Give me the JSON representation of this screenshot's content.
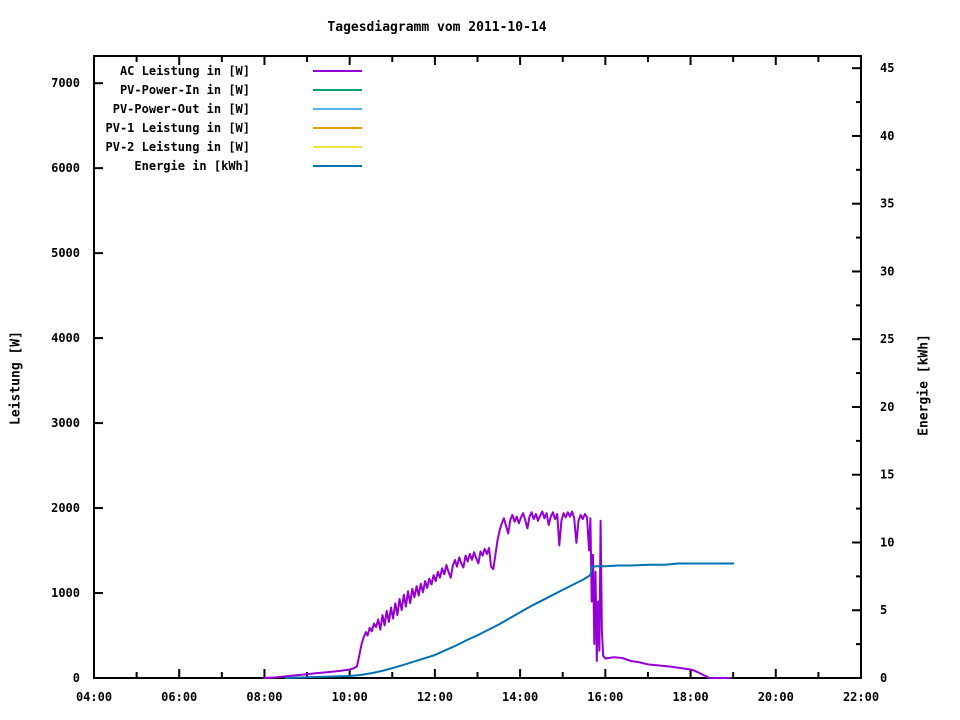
{
  "chart_data": {
    "type": "line",
    "title": "Tagesdiagramm vom 2011-10-14",
    "ylabel": "Leistung [W]",
    "y2label": "Energie [kWh]",
    "grid": false,
    "legend_position": "top-left-inside",
    "x_axis": {
      "min": 4,
      "max": 22,
      "major_ticks": [
        {
          "t": 4,
          "label": "04:00"
        },
        {
          "t": 6,
          "label": "06:00"
        },
        {
          "t": 8,
          "label": "08:00"
        },
        {
          "t": 10,
          "label": "10:00"
        },
        {
          "t": 12,
          "label": "12:00"
        },
        {
          "t": 14,
          "label": "14:00"
        },
        {
          "t": 16,
          "label": "16:00"
        },
        {
          "t": 18,
          "label": "18:00"
        },
        {
          "t": 20,
          "label": "20:00"
        },
        {
          "t": 22,
          "label": "22:00"
        }
      ],
      "minor_ticks": [
        5,
        7,
        9,
        11,
        13,
        15,
        17,
        19,
        21
      ]
    },
    "y_axis": {
      "min": 0,
      "max": 7320,
      "ticks": [
        0,
        1000,
        2000,
        3000,
        4000,
        5000,
        6000,
        7000
      ]
    },
    "y2_axis": {
      "min": 0,
      "max": 45.9,
      "ticks": [
        0,
        5,
        10,
        15,
        20,
        25,
        30,
        35,
        40,
        45
      ],
      "minor_ticks": [
        2.5,
        7.5,
        12.5,
        17.5,
        22.5,
        27.5,
        32.5,
        37.5,
        42.5
      ]
    },
    "series": [
      {
        "name": "AC Leistung in [W]",
        "color": "#9400d3",
        "axis": "y1",
        "points": [
          [
            8.0,
            0
          ],
          [
            8.3,
            10
          ],
          [
            8.6,
            25
          ],
          [
            8.9,
            40
          ],
          [
            9.2,
            55
          ],
          [
            9.5,
            70
          ],
          [
            9.8,
            85
          ],
          [
            10.0,
            100
          ],
          [
            10.1,
            115
          ],
          [
            10.17,
            135
          ],
          [
            10.22,
            250
          ],
          [
            10.28,
            400
          ],
          [
            10.33,
            480
          ],
          [
            10.38,
            540
          ],
          [
            10.42,
            500
          ],
          [
            10.47,
            590
          ],
          [
            10.52,
            550
          ],
          [
            10.57,
            640
          ],
          [
            10.62,
            600
          ],
          [
            10.67,
            690
          ],
          [
            10.72,
            570
          ],
          [
            10.77,
            740
          ],
          [
            10.82,
            620
          ],
          [
            10.87,
            790
          ],
          [
            10.92,
            660
          ],
          [
            10.97,
            830
          ],
          [
            11.02,
            700
          ],
          [
            11.07,
            880
          ],
          [
            11.12,
            740
          ],
          [
            11.17,
            930
          ],
          [
            11.22,
            800
          ],
          [
            11.27,
            980
          ],
          [
            11.32,
            840
          ],
          [
            11.37,
            1020
          ],
          [
            11.42,
            880
          ],
          [
            11.47,
            1050
          ],
          [
            11.52,
            950
          ],
          [
            11.57,
            1080
          ],
          [
            11.62,
            970
          ],
          [
            11.67,
            1110
          ],
          [
            11.72,
            1010
          ],
          [
            11.77,
            1140
          ],
          [
            11.82,
            1060
          ],
          [
            11.87,
            1170
          ],
          [
            11.92,
            1100
          ],
          [
            11.97,
            1210
          ],
          [
            12.02,
            1140
          ],
          [
            12.07,
            1250
          ],
          [
            12.12,
            1180
          ],
          [
            12.17,
            1290
          ],
          [
            12.22,
            1220
          ],
          [
            12.27,
            1330
          ],
          [
            12.32,
            1250
          ],
          [
            12.37,
            1180
          ],
          [
            12.42,
            1320
          ],
          [
            12.47,
            1390
          ],
          [
            12.52,
            1310
          ],
          [
            12.57,
            1420
          ],
          [
            12.62,
            1350
          ],
          [
            12.67,
            1300
          ],
          [
            12.72,
            1440
          ],
          [
            12.77,
            1370
          ],
          [
            12.82,
            1460
          ],
          [
            12.87,
            1390
          ],
          [
            12.92,
            1480
          ],
          [
            12.97,
            1410
          ],
          [
            13.02,
            1350
          ],
          [
            13.07,
            1490
          ],
          [
            13.12,
            1440
          ],
          [
            13.17,
            1520
          ],
          [
            13.22,
            1460
          ],
          [
            13.27,
            1530
          ],
          [
            13.32,
            1310
          ],
          [
            13.37,
            1280
          ],
          [
            13.42,
            1450
          ],
          [
            13.47,
            1620
          ],
          [
            13.52,
            1740
          ],
          [
            13.57,
            1820
          ],
          [
            13.62,
            1880
          ],
          [
            13.67,
            1790
          ],
          [
            13.72,
            1700
          ],
          [
            13.77,
            1860
          ],
          [
            13.82,
            1920
          ],
          [
            13.87,
            1840
          ],
          [
            13.92,
            1900
          ],
          [
            13.97,
            1820
          ],
          [
            14.02,
            1890
          ],
          [
            14.07,
            1940
          ],
          [
            14.12,
            1860
          ],
          [
            14.17,
            1760
          ],
          [
            14.22,
            1900
          ],
          [
            14.27,
            1950
          ],
          [
            14.32,
            1870
          ],
          [
            14.37,
            1930
          ],
          [
            14.42,
            1850
          ],
          [
            14.47,
            1910
          ],
          [
            14.52,
            1960
          ],
          [
            14.57,
            1880
          ],
          [
            14.62,
            1940
          ],
          [
            14.67,
            1800
          ],
          [
            14.72,
            1900
          ],
          [
            14.77,
            1950
          ],
          [
            14.82,
            1870
          ],
          [
            14.87,
            1930
          ],
          [
            14.92,
            1560
          ],
          [
            14.97,
            1850
          ],
          [
            15.02,
            1940
          ],
          [
            15.07,
            1890
          ],
          [
            15.12,
            1950
          ],
          [
            15.17,
            1900
          ],
          [
            15.22,
            1960
          ],
          [
            15.27,
            1880
          ],
          [
            15.32,
            1590
          ],
          [
            15.37,
            1850
          ],
          [
            15.42,
            1920
          ],
          [
            15.47,
            1870
          ],
          [
            15.52,
            1930
          ],
          [
            15.57,
            1890
          ],
          [
            15.62,
            1500
          ],
          [
            15.65,
            1880
          ],
          [
            15.68,
            900
          ],
          [
            15.71,
            1450
          ],
          [
            15.74,
            400
          ],
          [
            15.77,
            1250
          ],
          [
            15.8,
            200
          ],
          [
            15.83,
            900
          ],
          [
            15.86,
            320
          ],
          [
            15.89,
            1850
          ],
          [
            15.92,
            550
          ],
          [
            15.95,
            260
          ],
          [
            16.0,
            230
          ],
          [
            16.2,
            245
          ],
          [
            16.4,
            235
          ],
          [
            16.6,
            200
          ],
          [
            16.8,
            185
          ],
          [
            17.0,
            160
          ],
          [
            17.2,
            150
          ],
          [
            17.5,
            135
          ],
          [
            17.8,
            115
          ],
          [
            18.0,
            100
          ],
          [
            18.1,
            85
          ],
          [
            18.2,
            60
          ],
          [
            18.3,
            35
          ],
          [
            18.4,
            10
          ],
          [
            18.45,
            0
          ],
          [
            18.93,
            0
          ]
        ]
      },
      {
        "name": "PV-Power-In in [W]",
        "color": "#009e73",
        "axis": "y1",
        "points": []
      },
      {
        "name": "PV-Power-Out in [W]",
        "color": "#56b4e9",
        "axis": "y1",
        "points": []
      },
      {
        "name": "PV-1 Leistung in [W]",
        "color": "#e69f00",
        "axis": "y1",
        "points": []
      },
      {
        "name": "PV-2 Leistung in [W]",
        "color": "#f0e442",
        "axis": "y1",
        "points": []
      },
      {
        "name": "Energie in [kWh]",
        "color": "#0072b2",
        "axis": "y2",
        "points": [
          [
            8.5,
            0
          ],
          [
            9.0,
            0.05
          ],
          [
            9.5,
            0.1
          ],
          [
            10.0,
            0.15
          ],
          [
            10.25,
            0.22
          ],
          [
            10.5,
            0.35
          ],
          [
            10.75,
            0.52
          ],
          [
            11.0,
            0.72
          ],
          [
            11.25,
            0.95
          ],
          [
            11.5,
            1.2
          ],
          [
            11.75,
            1.45
          ],
          [
            12.0,
            1.7
          ],
          [
            12.25,
            2.05
          ],
          [
            12.5,
            2.4
          ],
          [
            12.75,
            2.8
          ],
          [
            13.0,
            3.15
          ],
          [
            13.25,
            3.55
          ],
          [
            13.5,
            3.95
          ],
          [
            13.75,
            4.4
          ],
          [
            14.0,
            4.85
          ],
          [
            14.25,
            5.3
          ],
          [
            14.5,
            5.7
          ],
          [
            14.75,
            6.1
          ],
          [
            15.0,
            6.5
          ],
          [
            15.25,
            6.9
          ],
          [
            15.5,
            7.3
          ],
          [
            15.6,
            7.5
          ],
          [
            15.65,
            7.6
          ],
          [
            15.68,
            8.2
          ],
          [
            15.8,
            8.25
          ],
          [
            16.0,
            8.25
          ],
          [
            16.3,
            8.3
          ],
          [
            16.6,
            8.3
          ],
          [
            17.0,
            8.35
          ],
          [
            17.4,
            8.35
          ],
          [
            17.7,
            8.45
          ],
          [
            18.0,
            8.45
          ],
          [
            18.5,
            8.45
          ],
          [
            19.0,
            8.45
          ]
        ]
      }
    ]
  }
}
